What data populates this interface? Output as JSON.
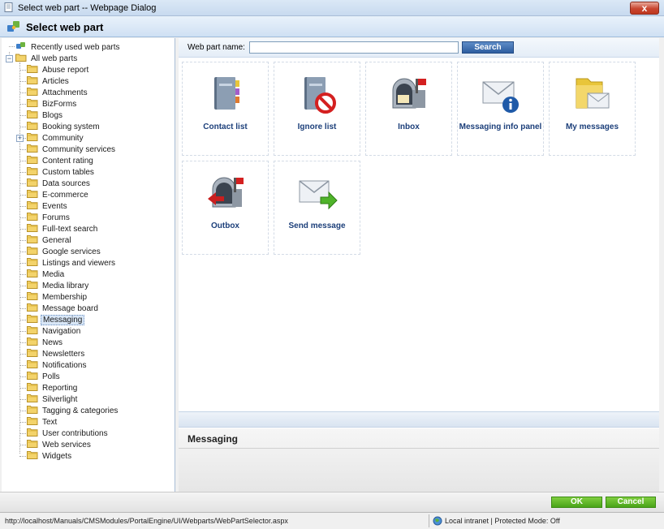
{
  "window": {
    "title": "Select web part -- Webpage Dialog",
    "close_label": "x"
  },
  "header": {
    "title": "Select web part"
  },
  "tree": {
    "recent": "Recently used web parts",
    "root": "All web parts",
    "items": [
      "Abuse report",
      "Articles",
      "Attachments",
      "BizForms",
      "Blogs",
      "Booking system",
      "Community",
      "Community services",
      "Content rating",
      "Custom tables",
      "Data sources",
      "E-commerce",
      "Events",
      "Forums",
      "Full-text search",
      "General",
      "Google services",
      "Listings and viewers",
      "Media",
      "Media library",
      "Membership",
      "Message board",
      "Messaging",
      "Navigation",
      "News",
      "Newsletters",
      "Notifications",
      "Polls",
      "Reporting",
      "Silverlight",
      "Tagging & categories",
      "Text",
      "User contributions",
      "Web services",
      "Widgets"
    ],
    "selected": "Messaging"
  },
  "search": {
    "label": "Web part name:",
    "value": "",
    "button": "Search"
  },
  "webparts": [
    {
      "label": "Contact list",
      "icon": "contact-book-icon"
    },
    {
      "label": "Ignore list",
      "icon": "blocked-book-icon"
    },
    {
      "label": "Inbox",
      "icon": "mailbox-in-icon"
    },
    {
      "label": "Messaging info panel",
      "icon": "envelope-info-icon"
    },
    {
      "label": "My messages",
      "icon": "folder-envelope-icon"
    },
    {
      "label": "Outbox",
      "icon": "mailbox-out-icon"
    },
    {
      "label": "Send message",
      "icon": "envelope-send-icon"
    }
  ],
  "description": {
    "title": "Messaging"
  },
  "footer": {
    "ok": "OK",
    "cancel": "Cancel"
  },
  "status": {
    "url": "http://localhost/Manuals/CMSModules/PortalEngine/UI/Webparts/WebPartSelector.aspx",
    "zone": "Local intranet | Protected Mode: Off"
  }
}
